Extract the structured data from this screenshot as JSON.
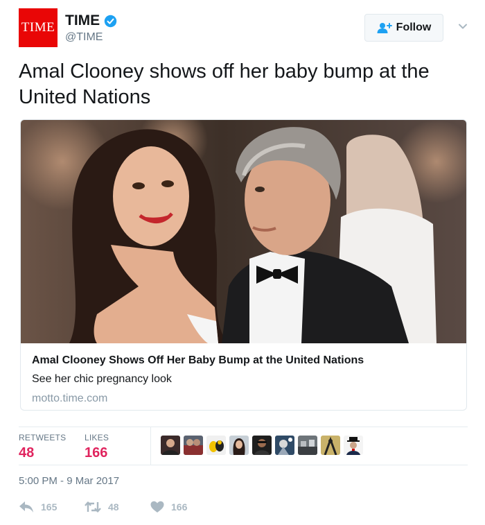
{
  "account": {
    "logo_text": "TIME",
    "display_name": "TIME",
    "handle": "@TIME",
    "verified_icon": "verified-badge-icon",
    "follow_label": "Follow"
  },
  "tweet": {
    "text": "Amal Clooney shows off her baby bump at the United Nations"
  },
  "card": {
    "title": "Amal Clooney Shows Off Her Baby Bump at the United Nations",
    "description": "See her chic pregnancy look",
    "domain": "motto.time.com"
  },
  "stats": {
    "retweets_label": "RETWEETS",
    "retweets_value": "48",
    "likes_label": "LIKES",
    "likes_value": "166",
    "liker_avatar_count": 9
  },
  "timestamp": "5:00 PM - 9 Mar 2017",
  "actions": {
    "reply_count": "165",
    "retweet_count": "48",
    "like_count": "166"
  },
  "colors": {
    "brand_red": "#e90606",
    "like_pink": "#e0245e",
    "verified_blue": "#1da1f2",
    "muted_gray": "#657786",
    "action_gray": "#aab8c2"
  }
}
